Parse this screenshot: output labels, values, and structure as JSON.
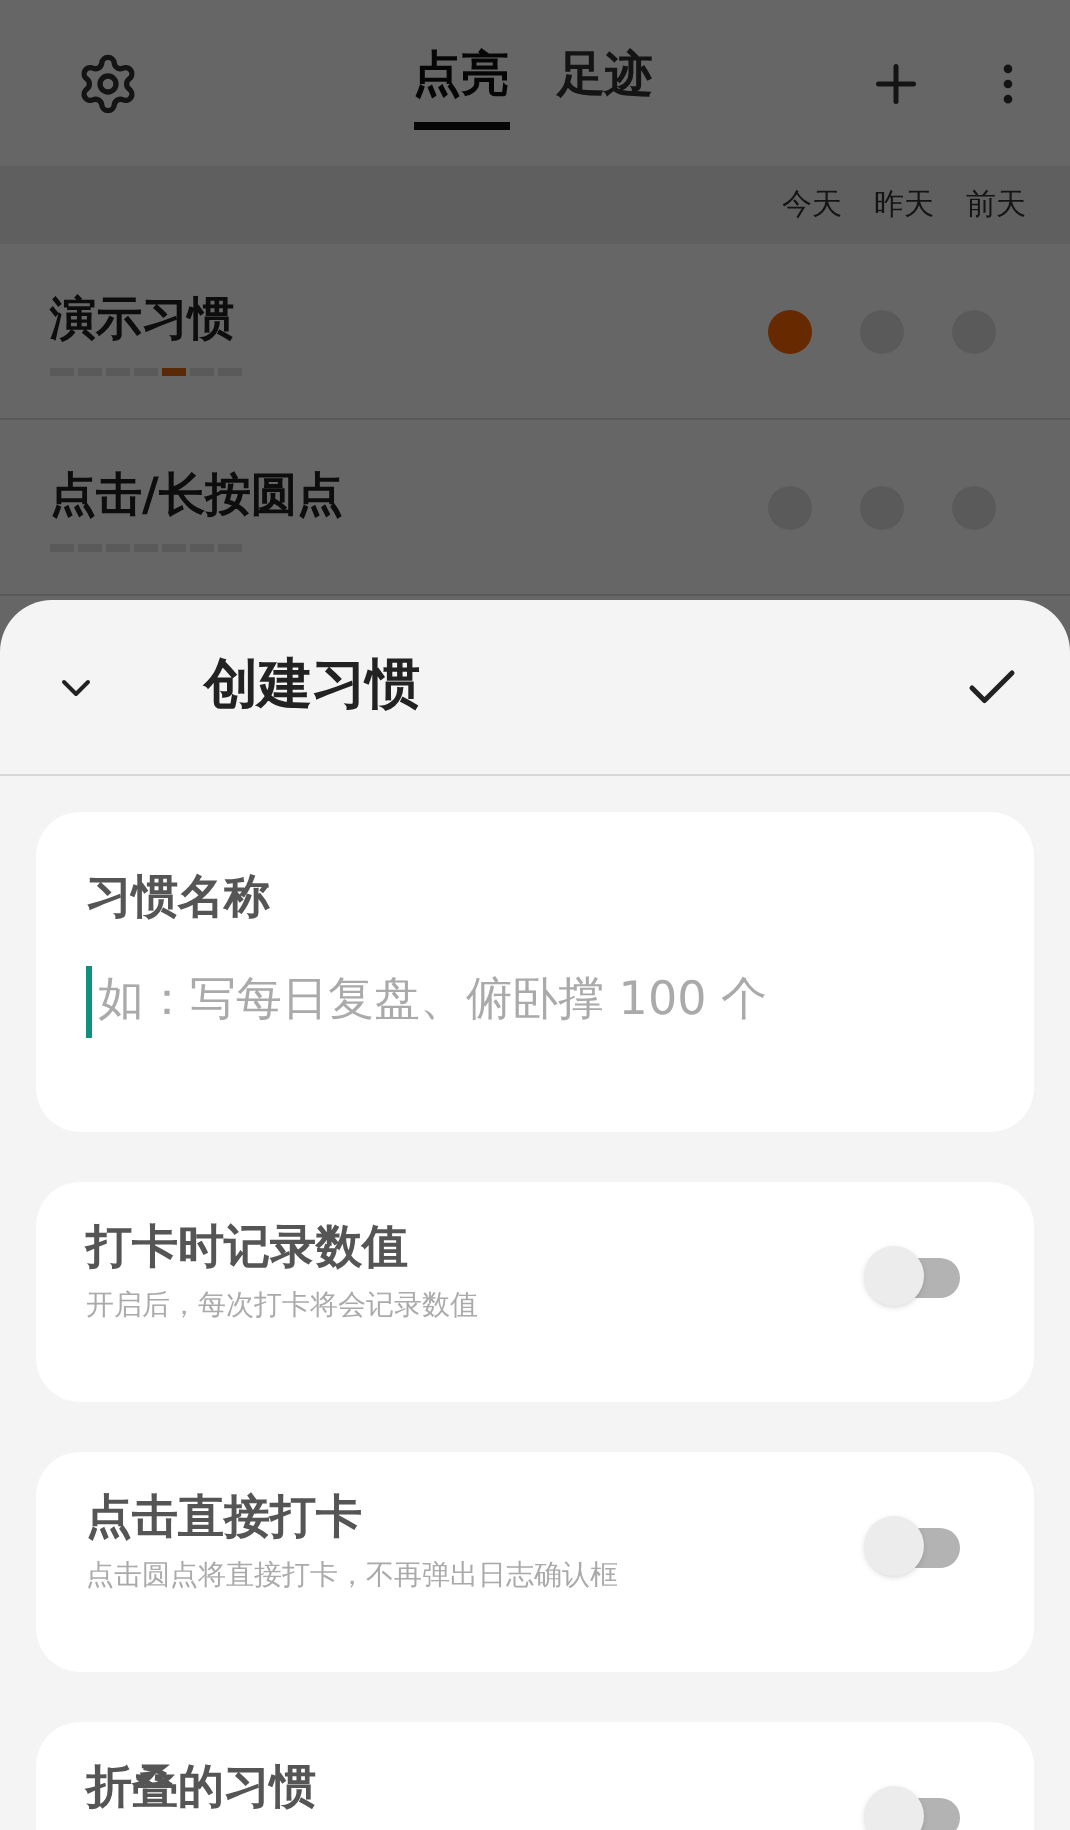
{
  "tabs": [
    {
      "label": "点亮",
      "selected": true
    },
    {
      "label": "足迹",
      "selected": false
    }
  ],
  "day_headers": [
    "今天",
    "昨天",
    "前天"
  ],
  "habits": [
    {
      "name": "演示习惯",
      "days": [
        {
          "done": true
        },
        {
          "done": false
        },
        {
          "done": false
        }
      ],
      "week": [
        {
          "lit": false
        },
        {
          "lit": false
        },
        {
          "lit": false
        },
        {
          "lit": false
        },
        {
          "lit": true
        },
        {
          "lit": false
        },
        {
          "lit": false
        }
      ]
    },
    {
      "name": "点击/长按圆点",
      "days": [
        {
          "done": false
        },
        {
          "done": false
        },
        {
          "done": false
        }
      ],
      "week": [
        {
          "lit": false
        },
        {
          "lit": false
        },
        {
          "lit": false
        },
        {
          "lit": false
        },
        {
          "lit": false
        },
        {
          "lit": false
        },
        {
          "lit": false
        }
      ]
    }
  ],
  "sheet": {
    "title": "创建习惯",
    "name_label": "习惯名称",
    "name_placeholder": "如：写每日复盘、俯卧撑 100 个",
    "options": [
      {
        "title": "打卡时记录数值",
        "description": "开启后，每次打卡将会记录数值",
        "on": false
      },
      {
        "title": "点击直接打卡",
        "description": "点击圆点将直接打卡，不再弹出日志确认框",
        "on": false
      },
      {
        "title": "折叠的习惯",
        "on": false
      }
    ]
  }
}
